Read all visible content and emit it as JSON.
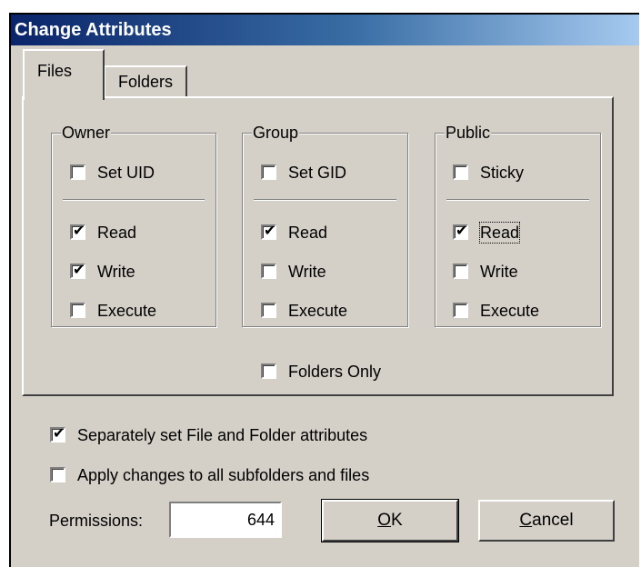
{
  "window": {
    "title": "Change Attributes"
  },
  "tabs": [
    {
      "label": "Files",
      "active": true
    },
    {
      "label": "Folders",
      "active": false
    }
  ],
  "groups": {
    "owner": {
      "title": "Owner",
      "special": "Set UID",
      "read": "Read",
      "write": "Write",
      "execute": "Execute"
    },
    "group": {
      "title": "Group",
      "special": "Set GID",
      "read": "Read",
      "write": "Write",
      "execute": "Execute"
    },
    "public": {
      "title": "Public",
      "special": "Sticky",
      "read": "Read",
      "write": "Write",
      "execute": "Execute"
    }
  },
  "checked": {
    "owner_special": false,
    "owner_read": true,
    "owner_write": true,
    "owner_execute": false,
    "group_special": false,
    "group_read": true,
    "group_write": false,
    "group_execute": false,
    "public_special": false,
    "public_read": true,
    "public_write": false,
    "public_execute": false,
    "folders_only": false,
    "separately_set": true,
    "apply_subfolders": false
  },
  "options": {
    "folders_only": "Folders Only",
    "separately_set": "Separately set File and Folder attributes",
    "apply_subfolders": "Apply changes to all subfolders and files"
  },
  "permissions": {
    "label": "Permissions:",
    "value": "644"
  },
  "buttons": {
    "ok_mnemonic": "O",
    "ok_rest": "K",
    "cancel_mnemonic": "C",
    "cancel_rest": "ancel"
  },
  "colors": {
    "title_start": "#0a246a",
    "title_end": "#a6caf0",
    "face": "#d4d0c8"
  }
}
